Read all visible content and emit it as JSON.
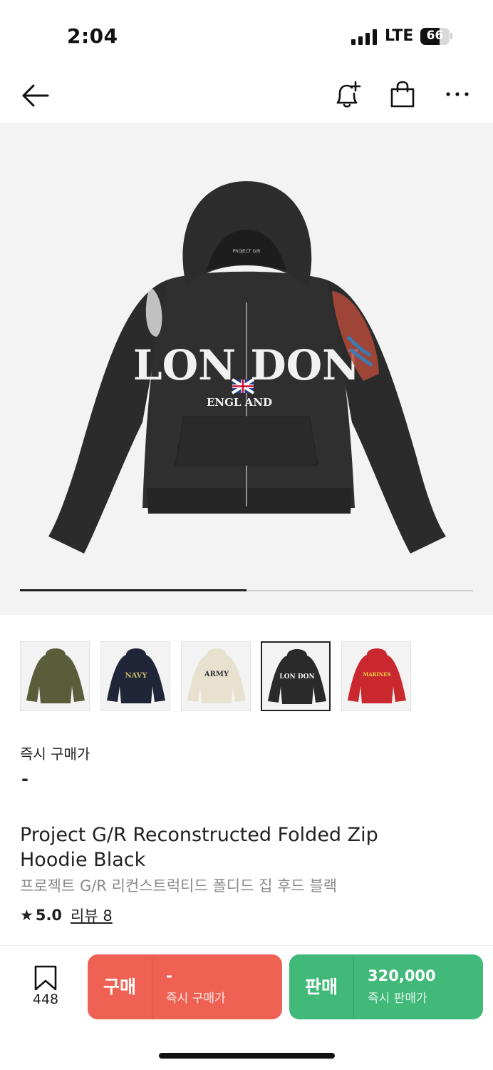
{
  "status_bar": {
    "time": "2:04",
    "network": "LTE",
    "battery": "66",
    "battery_level": 0.66
  },
  "nav": {
    "back_icon": "arrow-left-icon",
    "alert_icon": "bell-plus-icon",
    "bag_icon": "shopping-bag-icon",
    "more_icon": "more-horizontal-icon"
  },
  "gallery": {
    "main_image": "black zip hoodie with LONDON ENGLAND print",
    "print_text_1": "LON DON",
    "print_text_2": "ENGL AND",
    "brand_tag": "PROJECT G/R",
    "slide_progress": 0.5
  },
  "thumbnails": [
    {
      "color": "#5a5d3a",
      "label": "",
      "selected": false
    },
    {
      "color": "#1e2638",
      "label": "NAVY",
      "selected": false
    },
    {
      "color": "#e8e1d0",
      "label": "ARMY",
      "selected": false
    },
    {
      "color": "#2a2a2a",
      "label": "LON DON",
      "selected": true
    },
    {
      "color": "#c9282f",
      "label": "MARINES",
      "selected": false
    }
  ],
  "price": {
    "label": "즉시 구매가",
    "value": "-"
  },
  "product": {
    "title": "Project G/R Reconstructed Folded Zip Hoodie Black",
    "subtitle": "프로젝트 G/R 리컨스트럭티드 폴디드 집 후드 블랙",
    "rating": "5.0",
    "review_label": "리뷰 8"
  },
  "bottom_bar": {
    "wish_count": "448",
    "buy": {
      "label": "구매",
      "price": "-",
      "sub": "즉시 구매가"
    },
    "sell": {
      "label": "판매",
      "price": "320,000",
      "sub": "즉시 판매가"
    }
  },
  "colors": {
    "buy": "#ef6253",
    "sell": "#41b979",
    "gallery_bg": "#f3f3f3"
  }
}
